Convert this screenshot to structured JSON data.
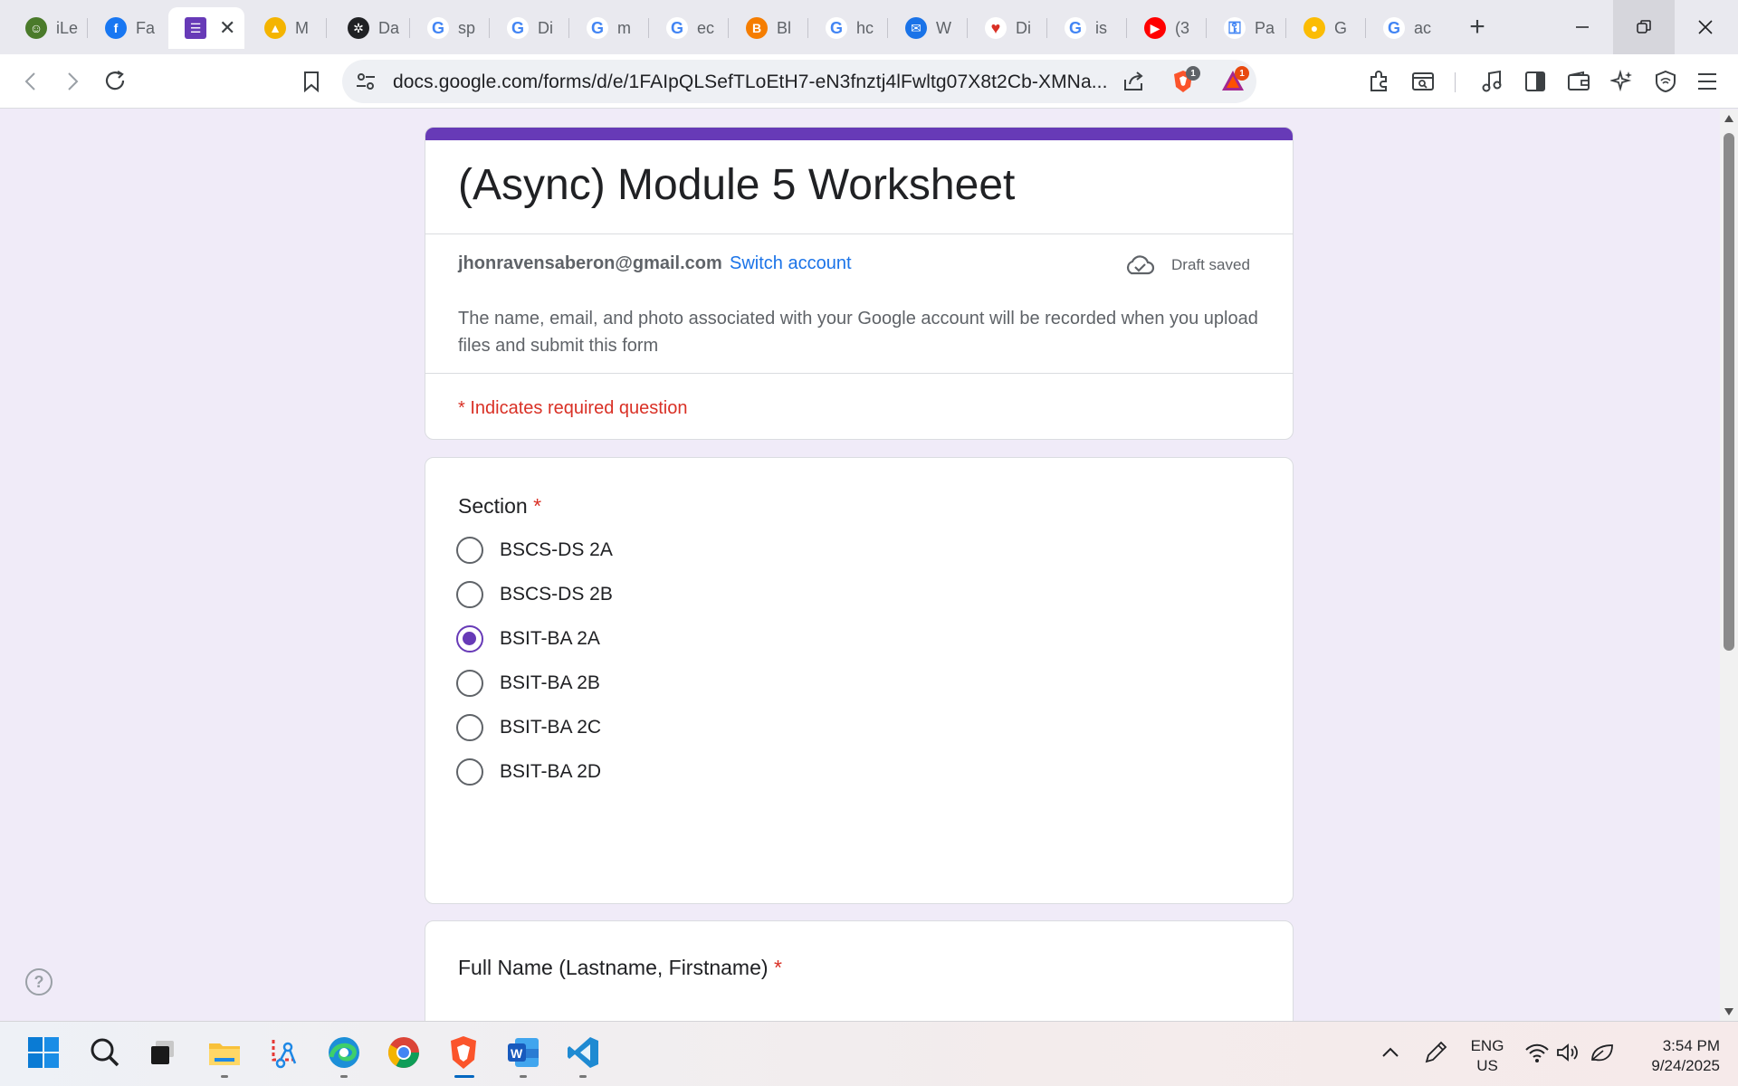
{
  "browser": {
    "tabs": [
      {
        "label": "iLe",
        "icon": "ilearn-icon",
        "color": "#4a7a2a",
        "glyph": "☺"
      },
      {
        "label": "Fa",
        "icon": "facebook-icon",
        "color": "#1877f2",
        "glyph": "f"
      },
      {
        "label": "",
        "icon": "google-forms-icon",
        "color": "#673ab7",
        "glyph": "☰",
        "active": true
      },
      {
        "label": "M",
        "icon": "google-drive-icon",
        "color": "#f4b400",
        "glyph": "▲"
      },
      {
        "label": "Da",
        "icon": "chatgpt-icon",
        "color": "#202124",
        "glyph": "✲"
      },
      {
        "label": "sp",
        "icon": "google-icon",
        "color": "#ffffff",
        "glyph": "G"
      },
      {
        "label": "Di",
        "icon": "google-icon",
        "color": "#ffffff",
        "glyph": "G"
      },
      {
        "label": "m",
        "icon": "google-icon",
        "color": "#ffffff",
        "glyph": "G"
      },
      {
        "label": "ec",
        "icon": "google-icon",
        "color": "#ffffff",
        "glyph": "G"
      },
      {
        "label": "Bl",
        "icon": "blogger-icon",
        "color": "#f57d00",
        "glyph": "B"
      },
      {
        "label": "hc",
        "icon": "google-icon",
        "color": "#ffffff",
        "glyph": "G"
      },
      {
        "label": "W",
        "icon": "chat-icon",
        "color": "#1a73e8",
        "glyph": "✉"
      },
      {
        "label": "Di",
        "icon": "heart-icon",
        "color": "#ffffff",
        "glyph": "♥"
      },
      {
        "label": "is",
        "icon": "google-icon",
        "color": "#ffffff",
        "glyph": "G"
      },
      {
        "label": "(3",
        "icon": "youtube-icon",
        "color": "#ff0000",
        "glyph": "▶"
      },
      {
        "label": "Pa",
        "icon": "password-key-icon",
        "color": "#ffffff",
        "glyph": "⚿"
      },
      {
        "label": "G",
        "icon": "google-keep-icon",
        "color": "#fbbc04",
        "glyph": "●"
      },
      {
        "label": "ac",
        "icon": "google-icon",
        "color": "#ffffff",
        "glyph": "G"
      }
    ],
    "new_tab": "+",
    "url": "docs.google.com/forms/d/e/1FAIpQLSefTLoEtH7-eN3fnztj4lFwltg07X8t2Cb-XMNa...",
    "shield_badge": "1",
    "rewards_badge": "1"
  },
  "form": {
    "title": "(Async) Module 5 Worksheet",
    "account_email": "jhonravensaberon@gmail.com",
    "switch_account": "Switch account",
    "draft_status": "Draft saved",
    "notice": "The name, email, and photo associated with your Google account will be recorded when you upload files and submit this form",
    "required_note": "* Indicates required question",
    "accent_color": "#673ab7",
    "section": {
      "label": "Section",
      "required_mark": "*",
      "options": [
        {
          "label": "BSCS-DS 2A",
          "selected": false
        },
        {
          "label": "BSCS-DS 2B",
          "selected": false
        },
        {
          "label": "BSIT-BA 2A",
          "selected": true
        },
        {
          "label": "BSIT-BA 2B",
          "selected": false
        },
        {
          "label": "BSIT-BA 2C",
          "selected": false
        },
        {
          "label": "BSIT-BA 2D",
          "selected": false
        }
      ]
    },
    "full_name": {
      "label": "Full Name (Lastname, Firstname)",
      "required_mark": "*"
    },
    "help": "?"
  },
  "taskbar": {
    "language": "ENG",
    "region": "US",
    "time": "3:54 PM",
    "date": "9/24/2025"
  }
}
